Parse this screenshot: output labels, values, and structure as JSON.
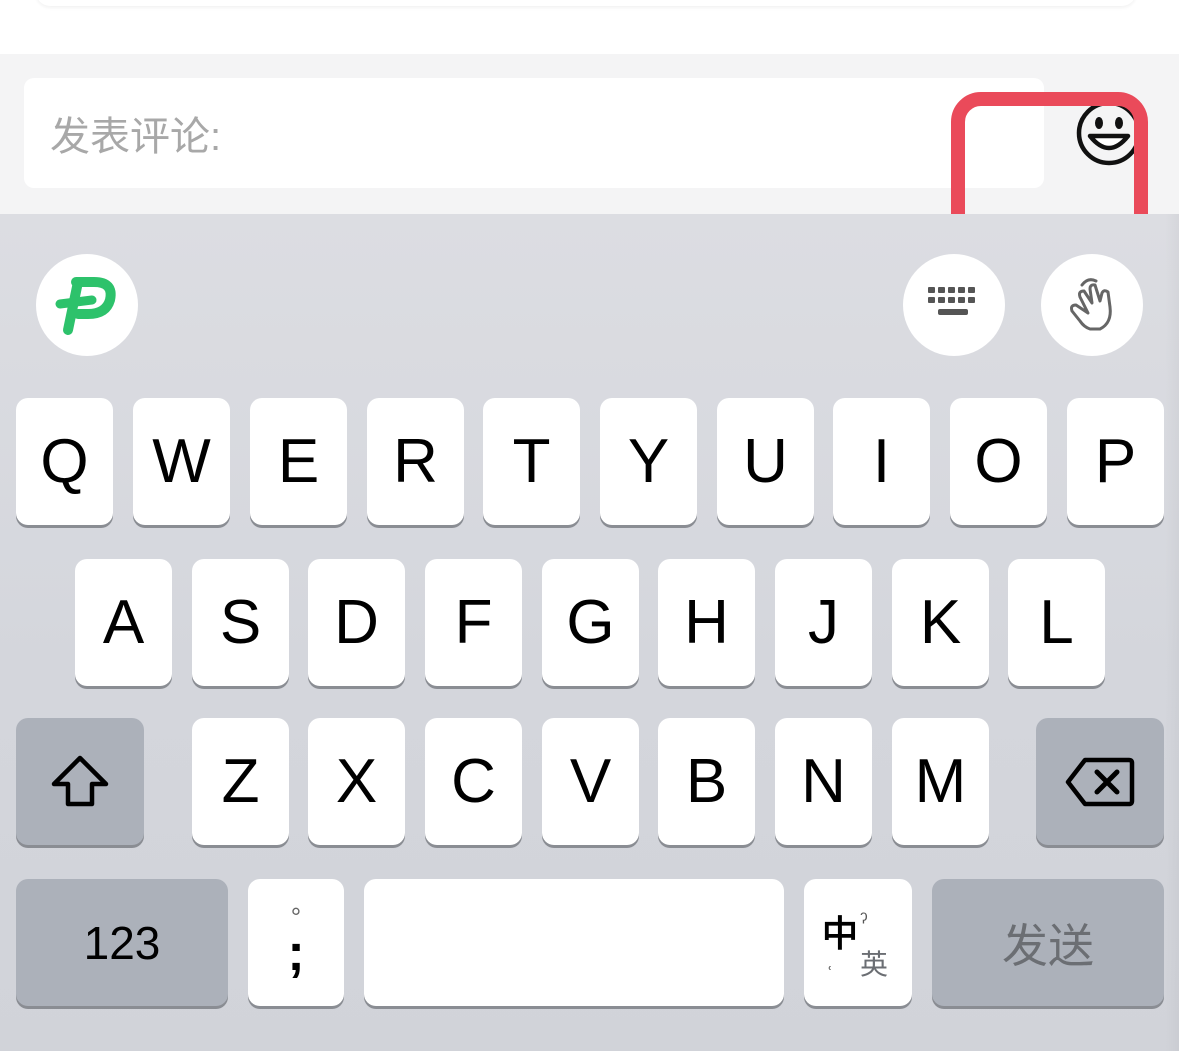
{
  "comment": {
    "placeholder": "发表评论:"
  },
  "icons": {
    "emoji": "smiley-face-icon",
    "brand": "green-p-logo-icon",
    "keyboard": "keyboard-icon",
    "gesture": "hand-swipe-icon",
    "shift": "shift-arrow-icon",
    "delete": "backspace-icon"
  },
  "keyboard": {
    "row1": [
      "Q",
      "W",
      "E",
      "R",
      "T",
      "Y",
      "U",
      "I",
      "O",
      "P"
    ],
    "row2": [
      "A",
      "S",
      "D",
      "F",
      "G",
      "H",
      "J",
      "K",
      "L"
    ],
    "row3": [
      "Z",
      "X",
      "C",
      "V",
      "B",
      "N",
      "M"
    ],
    "bottom": {
      "numbers": "123",
      "punct_top": "°",
      "punct_bottom": ";",
      "lang_main": "中",
      "lang_sub": "英",
      "send": "发送"
    }
  },
  "colors": {
    "highlight": "#ea4a5a",
    "brand_green": "#2dc26b",
    "key_gray": "#acb1ba"
  }
}
